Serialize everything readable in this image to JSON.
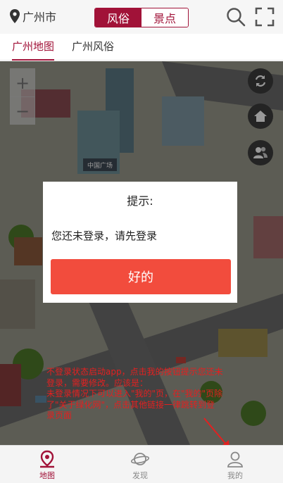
{
  "header": {
    "city": "广州市",
    "segment": {
      "active": "风俗",
      "inactive": "景点"
    },
    "icons": [
      "location-pin-icon",
      "search-icon",
      "fullscreen-icon"
    ]
  },
  "tabs": [
    "广州地图",
    "广州风俗"
  ],
  "map": {
    "zoom_in": "+",
    "zoom_out": "−",
    "side_buttons": [
      "refresh-icon",
      "home-icon",
      "users-icon"
    ],
    "billboard_text": "中国广场"
  },
  "dialog": {
    "title": "提示:",
    "message": "您还未登录，请先登录",
    "ok_label": "好的"
  },
  "annotation": {
    "lines": [
      "不登录状态启动app，点击我的按钮提示您还未",
      "登录，需要修改。应该是：",
      "未登录情况下可以进入\"我的\"页，在\"我的\"页除",
      "了\"关于绿化网\"，点击其他链接一律跳转到登",
      "录页面"
    ]
  },
  "bottom_nav": [
    {
      "label": "地图",
      "icon": "map-pin-icon",
      "active": true
    },
    {
      "label": "发现",
      "icon": "planet-icon",
      "active": false
    },
    {
      "label": "我的",
      "icon": "user-icon",
      "active": false
    }
  ],
  "colors": {
    "brand": "#a11238",
    "button": "#f24c3d",
    "annotation": "#e32020"
  }
}
